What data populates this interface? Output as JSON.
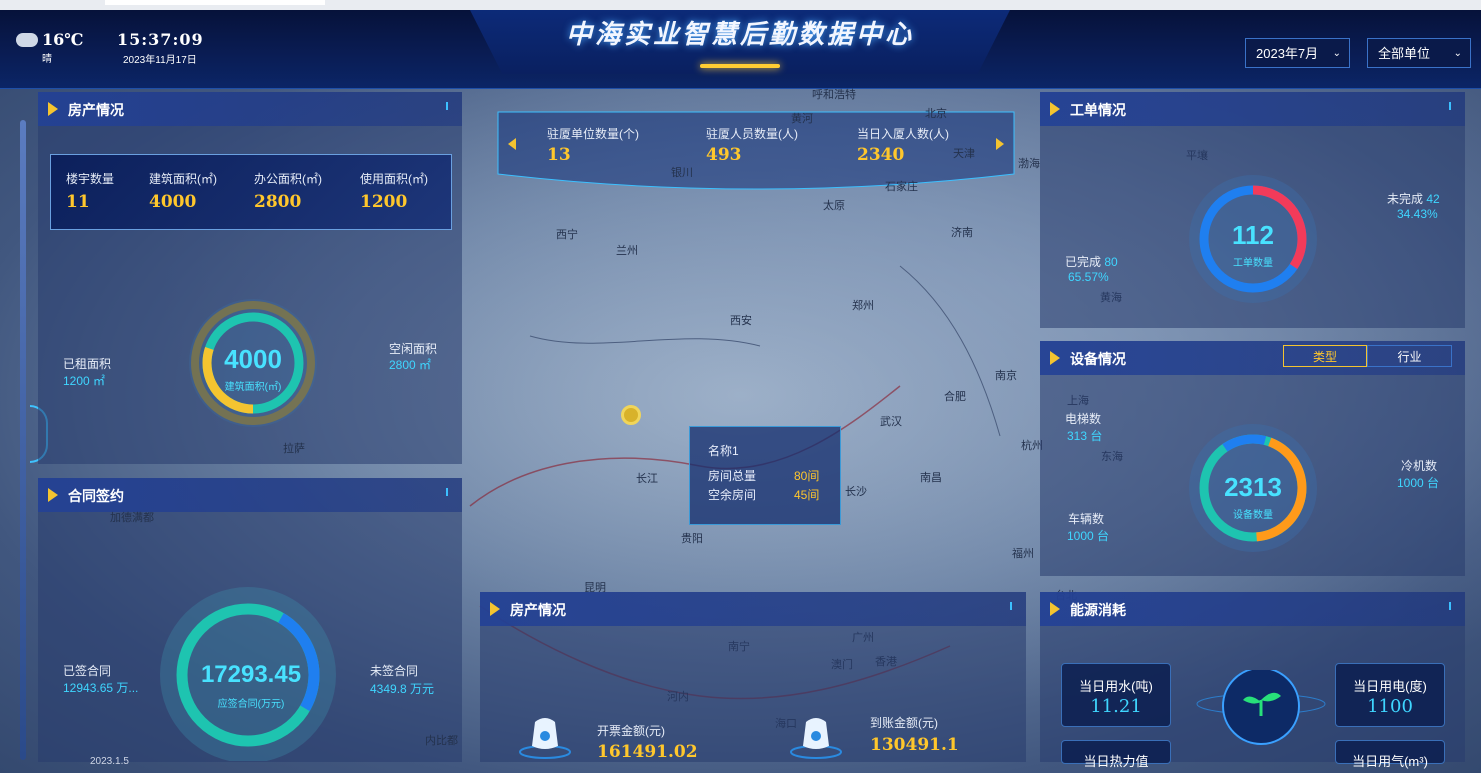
{
  "header": {
    "title": "中海实业智慧后勤数据中心",
    "weather_temp": "16℃",
    "weather_desc": "晴",
    "weather_icon": "cloud-rain-icon",
    "time": "15:37:09",
    "date": "2023年11月17日",
    "month_select": "2023年7月",
    "unit_select": "全部单位"
  },
  "property": {
    "title": "房产情况",
    "stats": [
      {
        "label": "楼宇数量",
        "value": "11"
      },
      {
        "label": "建筑面积(㎡)",
        "value": "4000"
      },
      {
        "label": "办公面积(㎡)",
        "value": "2800"
      },
      {
        "label": "使用面积(㎡)",
        "value": "1200"
      }
    ],
    "ring_value": "4000",
    "ring_label": "建筑面积(㎡)",
    "rented_label": "已租面积",
    "rented_value": "1200 ㎡",
    "idle_label": "空闲面积",
    "idle_value": "2800 ㎡",
    "colors": {
      "rented": "#f4c430",
      "idle": "#1ec4b0"
    }
  },
  "contract": {
    "title": "合同签约",
    "ring_value": "17293.45",
    "ring_label": "应签合同(万元)",
    "signed_label": "已签合同",
    "signed_value": "12943.65 万...",
    "unsigned_label": "未签合同",
    "unsigned_value": "4349.8 万元",
    "colors": {
      "signed": "#1ec4b0",
      "unsigned": "#1f7ff0"
    }
  },
  "top_stats": [
    {
      "label": "驻厦单位数量(个)",
      "value": "13"
    },
    {
      "label": "驻厦人员数量(人)",
      "value": "493"
    },
    {
      "label": "当日入厦人数(人)",
      "value": "2340"
    }
  ],
  "map_popup": {
    "name_label": "名称1",
    "rooms_label": "房间总量",
    "rooms_value": "80间",
    "free_label": "空余房间",
    "free_value": "45间"
  },
  "map_labels": [
    "呼和浩特",
    "北京",
    "天津",
    "银川",
    "石家庄",
    "太原",
    "西宁",
    "兰州",
    "济南",
    "郑州",
    "西安",
    "南京",
    "合肥",
    "武汉",
    "杭州",
    "长沙",
    "南昌",
    "贵阳",
    "福州",
    "昆明",
    "台北",
    "南宁",
    "广州",
    "澳门",
    "香港",
    "海口",
    "拉萨",
    "平壤",
    "上海",
    "东海",
    "黄河",
    "长江",
    "渤海",
    "黄海",
    "加德满都",
    "河内",
    "内比都"
  ],
  "revenue": {
    "title": "房产情况",
    "invoice_label": "开票金额(元)",
    "invoice_value": "161491.02",
    "received_label": "到账金额(元)",
    "received_value": "130491.1"
  },
  "workorder": {
    "title": "工单情况",
    "ring_value": "112",
    "ring_label": "工单数量",
    "done_label": "已完成",
    "done_count": "80",
    "done_pct": "65.57%",
    "undone_label": "未完成",
    "undone_count": "42",
    "undone_pct": "34.43%",
    "colors": {
      "done": "#1f7ff0",
      "undone": "#f23b5a"
    }
  },
  "equipment": {
    "title": "设备情况",
    "tab_type": "类型",
    "tab_industry": "行业",
    "ring_value": "2313",
    "ring_label": "设备数量",
    "elevator_label": "电梯数",
    "elevator_value": "313 台",
    "chiller_label": "冷机数",
    "chiller_value": "1000 台",
    "vehicle_label": "车辆数",
    "vehicle_value": "1000 台",
    "colors": {
      "elevator": "#1f7ff0",
      "chiller": "#ff9a1a",
      "vehicle": "#1ec4b0"
    }
  },
  "energy": {
    "title": "能源消耗",
    "water_label": "当日用水(吨)",
    "water_value": "11.21",
    "power_label": "当日用电(度)",
    "power_value": "1100",
    "heat_label": "当日热力值",
    "gas_label": "当日用气(m³)"
  },
  "bottom_left_text": "2023.1.5"
}
